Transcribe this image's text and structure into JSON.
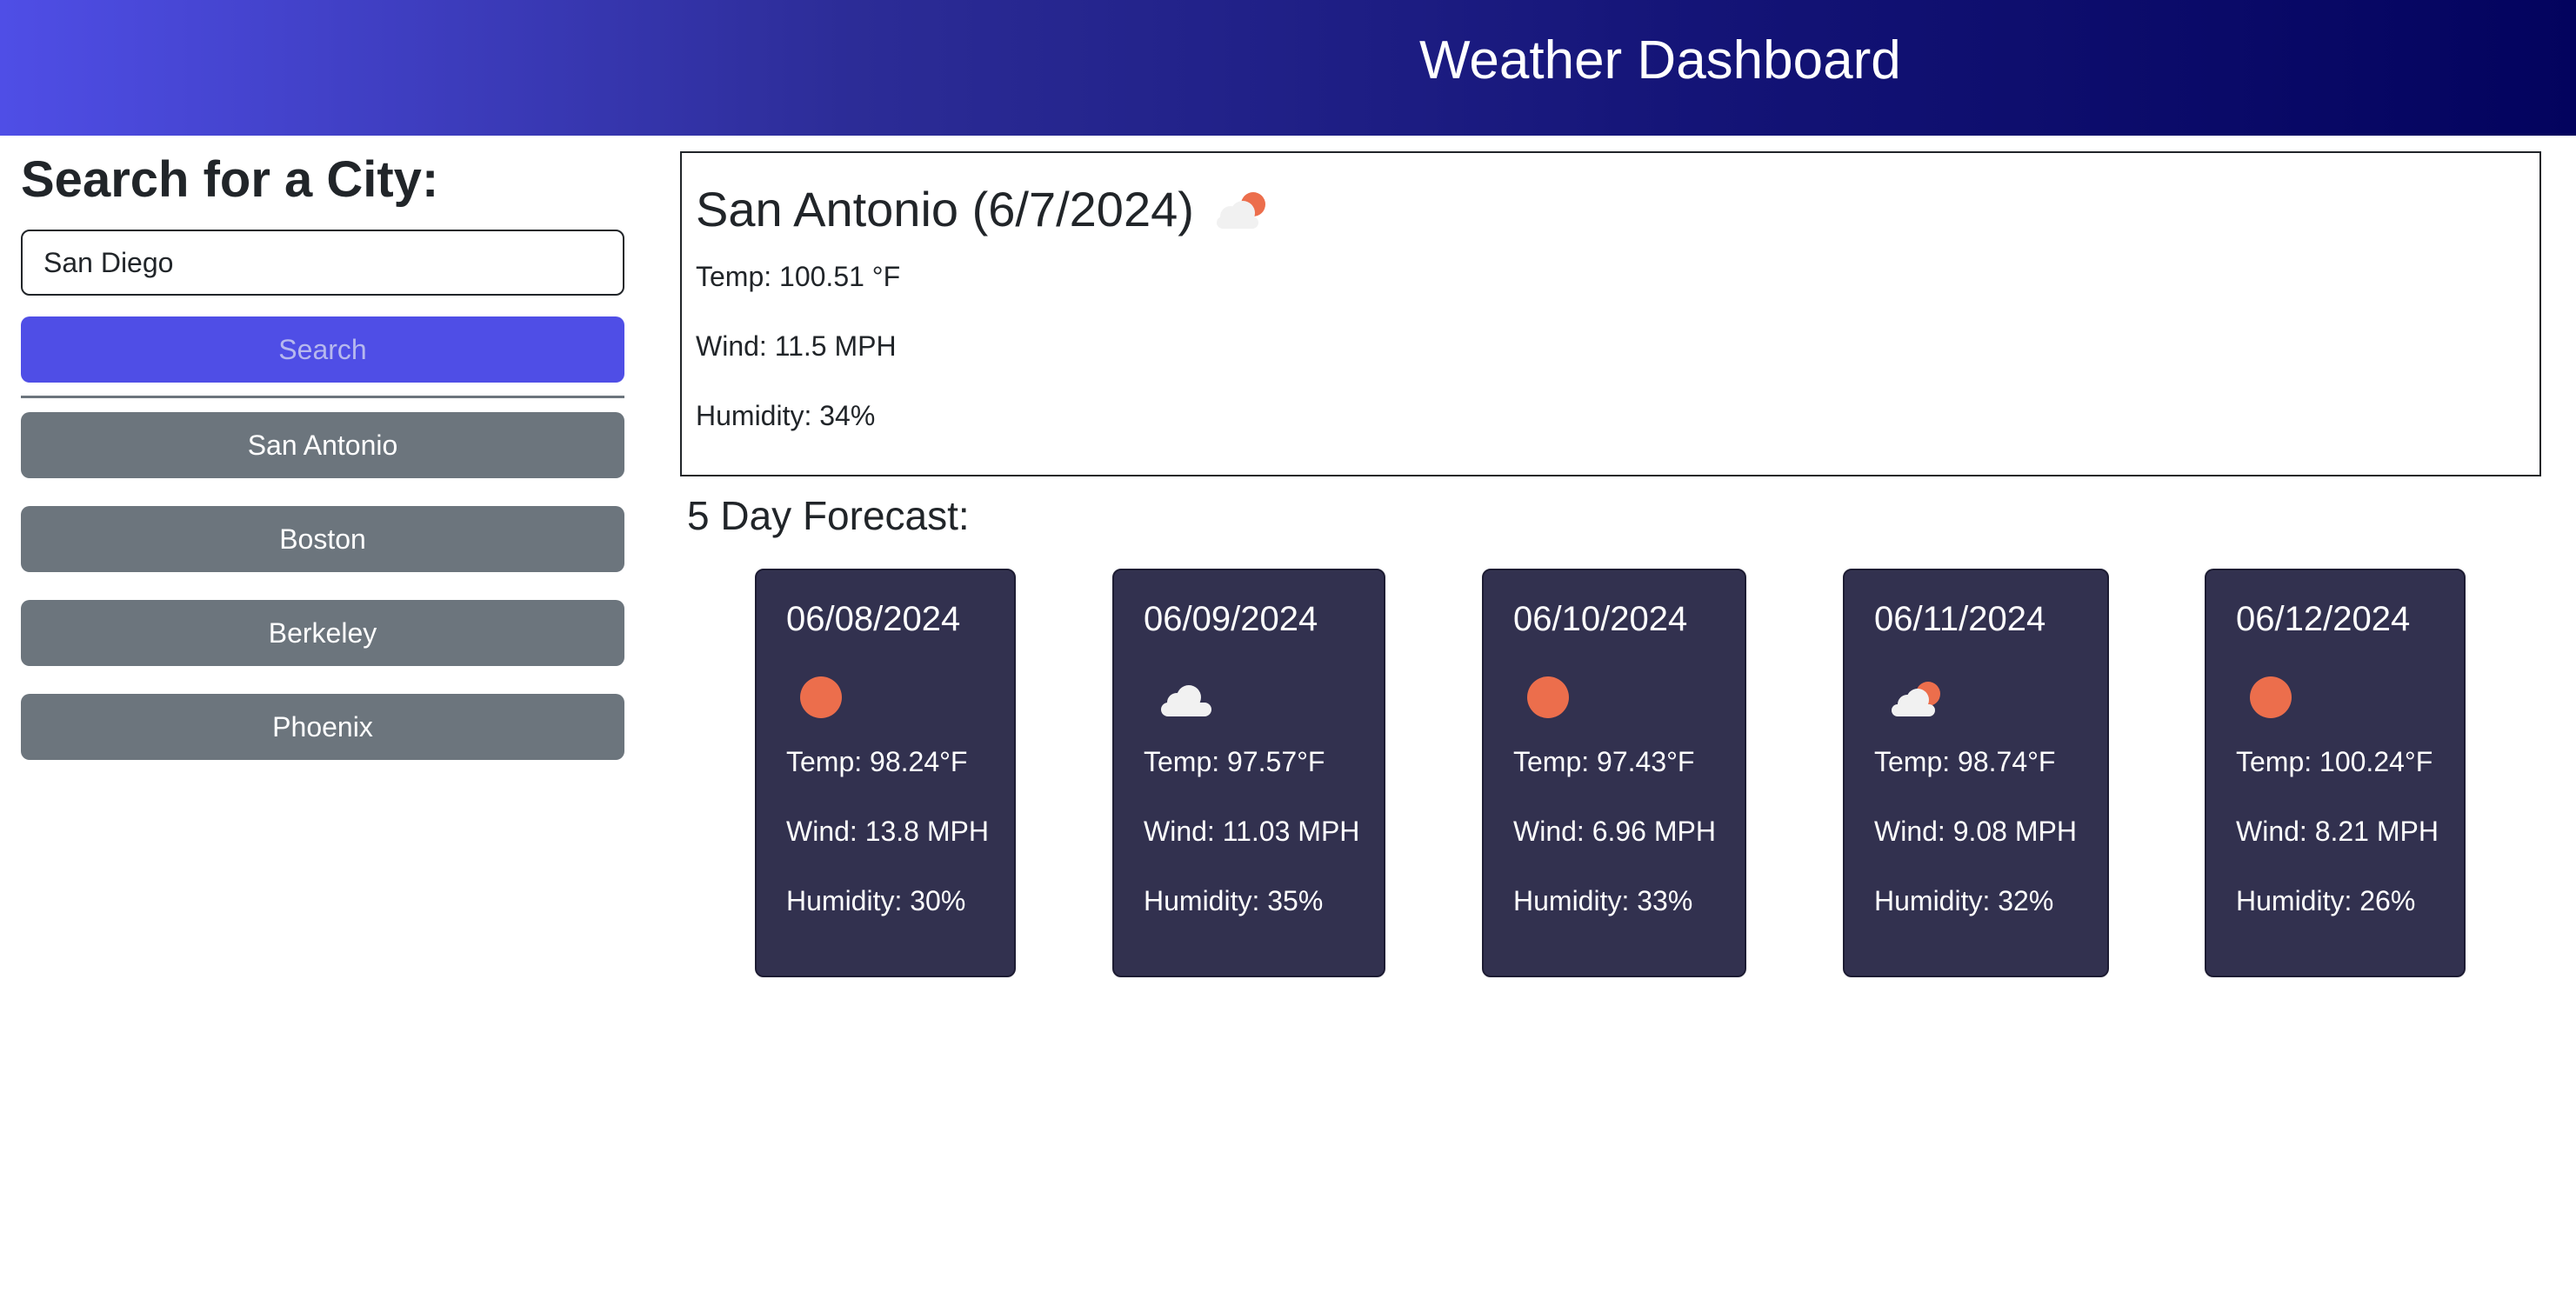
{
  "header": {
    "title": "Weather Dashboard"
  },
  "sidebar": {
    "heading": "Search for a City:",
    "search_input_value": "San Diego",
    "search_button_label": "Search",
    "history": [
      "San Antonio",
      "Boston",
      "Berkeley",
      "Phoenix"
    ]
  },
  "current": {
    "title": "San Antonio (6/7/2024)",
    "icon": "partly-cloudy-icon",
    "temp": "Temp: 100.51 °F",
    "wind": "Wind: 11.5 MPH",
    "humidity": "Humidity: 34%"
  },
  "forecast": {
    "heading": "5 Day Forecast:",
    "days": [
      {
        "date": "06/08/2024",
        "icon": "sun-icon",
        "temp": "Temp: 98.24°F",
        "wind": "Wind: 13.8 MPH",
        "humidity": "Humidity: 30%"
      },
      {
        "date": "06/09/2024",
        "icon": "cloud-icon",
        "temp": "Temp: 97.57°F",
        "wind": "Wind: 11.03 MPH",
        "humidity": "Humidity: 35%"
      },
      {
        "date": "06/10/2024",
        "icon": "sun-icon",
        "temp": "Temp: 97.43°F",
        "wind": "Wind: 6.96 MPH",
        "humidity": "Humidity: 33%"
      },
      {
        "date": "06/11/2024",
        "icon": "partly-cloudy-icon",
        "temp": "Temp: 98.74°F",
        "wind": "Wind: 9.08 MPH",
        "humidity": "Humidity: 32%"
      },
      {
        "date": "06/12/2024",
        "icon": "sun-icon",
        "temp": "Temp: 100.24°F",
        "wind": "Wind: 8.21 MPH",
        "humidity": "Humidity: 26%"
      }
    ]
  },
  "colors": {
    "header_gradient_start": "#4f4ee6",
    "header_gradient_end": "#03035e",
    "search_button": "#4f4ee6",
    "history_button": "#6c757d",
    "forecast_card": "#32314f",
    "sun": "#ec6e4c",
    "cloud": "#f1f1f1"
  }
}
